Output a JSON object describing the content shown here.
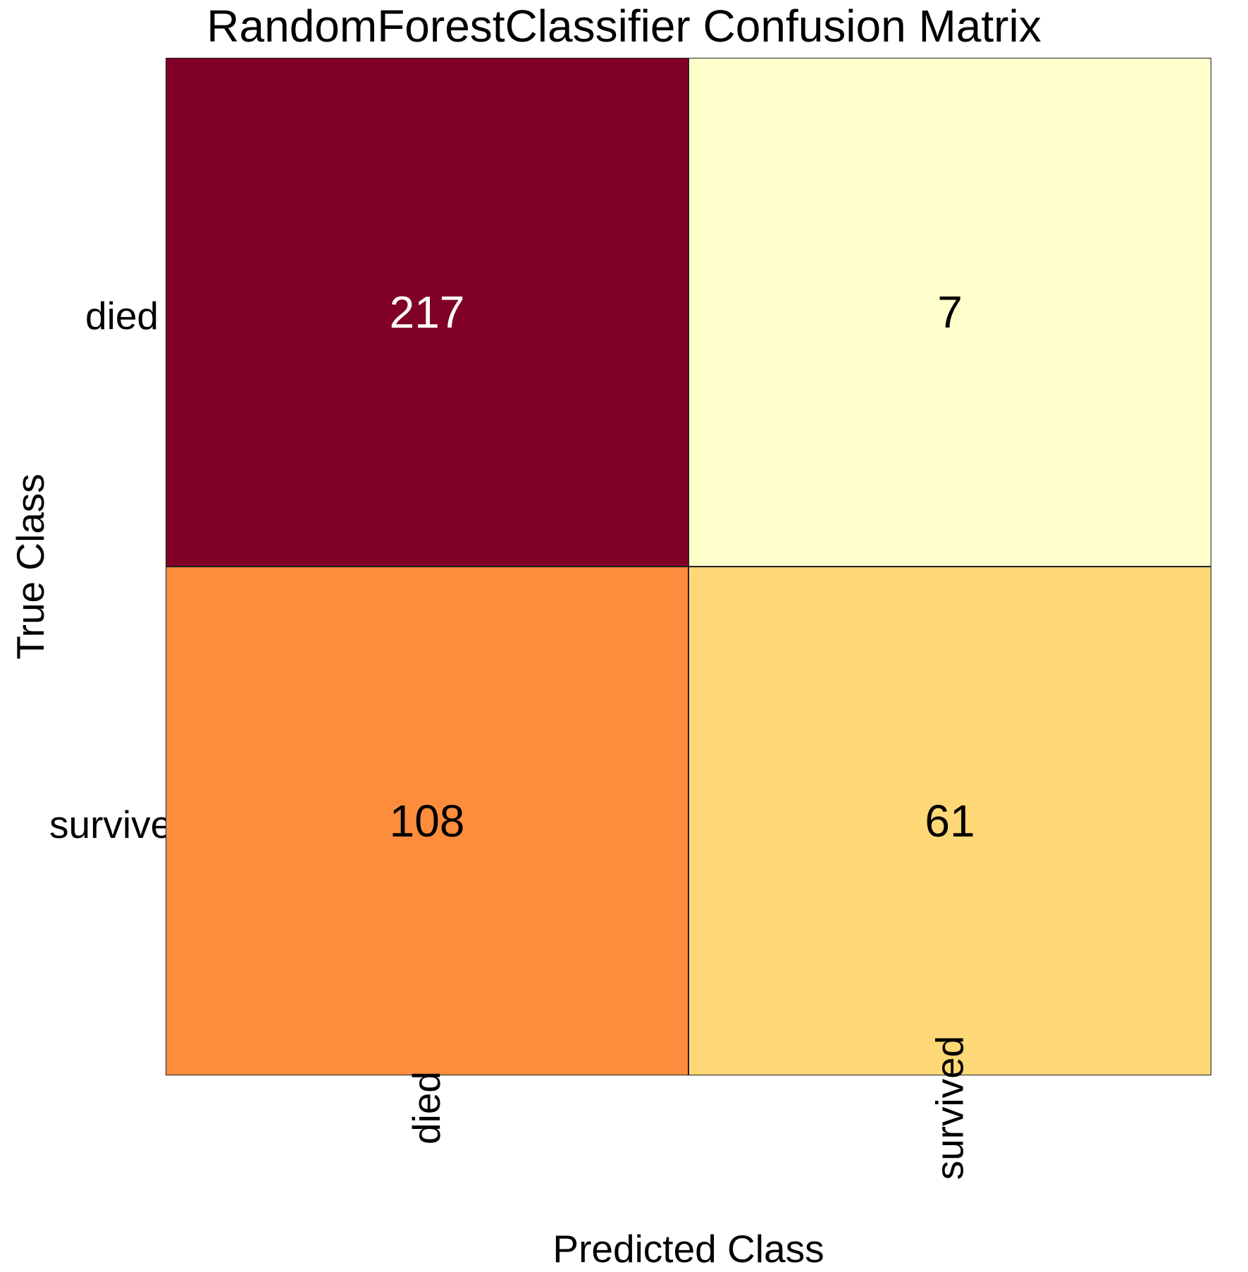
{
  "chart_data": {
    "type": "heatmap",
    "title": "RandomForestClassifier Confusion Matrix",
    "xlabel": "Predicted Class",
    "ylabel": "True Class",
    "x_categories": [
      "died",
      "survived"
    ],
    "y_categories": [
      "died",
      "survived"
    ],
    "values": [
      [
        217,
        7
      ],
      [
        108,
        61
      ]
    ],
    "cell_colors": [
      [
        "#800026",
        "#ffffcc"
      ],
      [
        "#fd8d3c",
        "#fed776"
      ]
    ],
    "cell_text_colors": [
      [
        "light",
        "dark"
      ],
      [
        "dark",
        "dark"
      ]
    ]
  }
}
